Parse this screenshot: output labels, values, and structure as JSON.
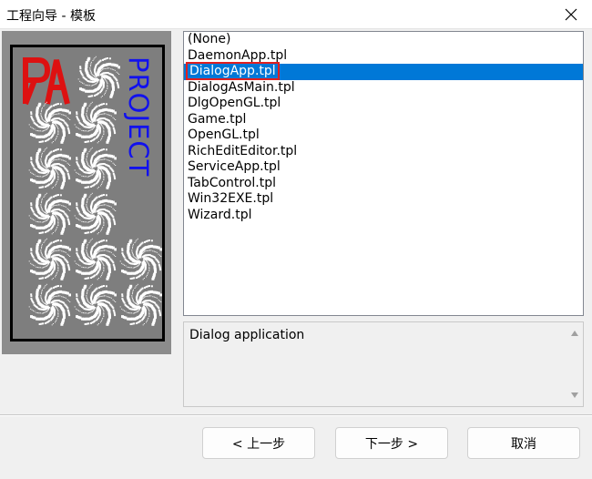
{
  "window": {
    "title": "工程向导 - 模板"
  },
  "image_panel": {
    "logo_text": "ЯA",
    "project_text": "PROJECT",
    "colors": {
      "background": "#7e7e7e",
      "logo": "#dd1111",
      "project": "#1111ee"
    }
  },
  "template_list": {
    "items": [
      {
        "label": "(None)"
      },
      {
        "label": "DaemonApp.tpl"
      },
      {
        "label": "DialogApp.tpl",
        "selected": true
      },
      {
        "label": "DialogAsMain.tpl"
      },
      {
        "label": "DlgOpenGL.tpl"
      },
      {
        "label": "Game.tpl"
      },
      {
        "label": "OpenGL.tpl"
      },
      {
        "label": "RichEditEditor.tpl"
      },
      {
        "label": "ServiceApp.tpl"
      },
      {
        "label": "TabControl.tpl"
      },
      {
        "label": "Win32EXE.tpl"
      },
      {
        "label": "Wizard.tpl"
      }
    ]
  },
  "description": {
    "text": "Dialog application"
  },
  "buttons": {
    "back": "< 上一步",
    "next": "下一步 >",
    "cancel": "取消"
  },
  "colors": {
    "selection": "#0078d7",
    "highlight_outline": "#e02020"
  }
}
